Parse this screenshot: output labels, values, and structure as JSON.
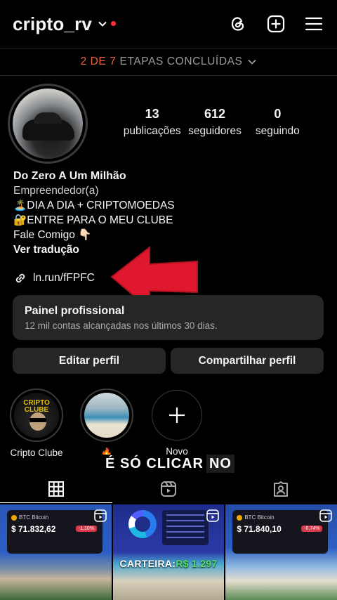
{
  "header": {
    "username": "cripto_rv"
  },
  "steps": {
    "count": "2 DE 7",
    "label": "ETAPAS CONCLUÍDAS"
  },
  "stats": [
    {
      "value": "13",
      "label": "publicações"
    },
    {
      "value": "612",
      "label": "seguidores"
    },
    {
      "value": "0",
      "label": "seguindo"
    }
  ],
  "bio": {
    "name": "Do Zero A Um Milhão",
    "category": "Empreendedor(a)",
    "line1": "🏝️DIA A DIA + CRIPTOMOEDAS",
    "line2": "🔐ENTRE PARA O MEU CLUBE",
    "line3": "Fale Comigo 👇🏻",
    "translate": "Ver tradução",
    "link": "ln.run/fFPFC"
  },
  "panel": {
    "title": "Painel profissional",
    "subtitle": "12 mil contas alcançadas nos últimos 30 dias."
  },
  "buttons": {
    "edit": "Editar perfil",
    "share": "Compartilhar perfil"
  },
  "highlights": [
    {
      "label": "Cripto Clube",
      "cover_text": "CRIPTO CLUBE"
    },
    {
      "label": "🔥"
    },
    {
      "label": "Novo"
    }
  ],
  "caption": {
    "text": "É SÓ CLICAR",
    "boxed": "NO"
  },
  "grid": [
    {
      "coin": "BTC Bitcoin",
      "price": "$ 71.832,62",
      "change": "-1,10%"
    },
    {
      "carteira_label": "CARTEIRA:",
      "carteira_value": "R$ 1.297"
    },
    {
      "coin": "BTC Bitcoin",
      "price": "$ 71.840,10",
      "change": "-0,74%"
    }
  ],
  "colors": {
    "background": "#000000",
    "steps_count": "#e8623f",
    "notification_dot": "#ff3040",
    "arrow": "#e0182d",
    "button_bg": "#262626"
  }
}
